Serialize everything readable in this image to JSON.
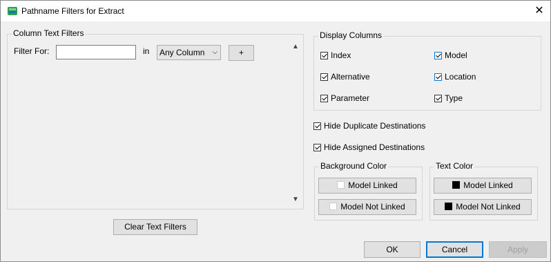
{
  "window": {
    "title": "Pathname Filters for Extract",
    "close_glyph": "✕"
  },
  "column_text_filters": {
    "legend": "Column Text Filters",
    "filter_for_label": "Filter For:",
    "filter_value": "",
    "in_label": "in",
    "column_select": "Any Column",
    "add_label": "+",
    "clear_label": "Clear Text Filters"
  },
  "display_columns": {
    "legend": "Display Columns",
    "items": [
      {
        "label": "Index",
        "checked": true
      },
      {
        "label": "Model",
        "checked": true
      },
      {
        "label": "Alternative",
        "checked": true
      },
      {
        "label": "Location",
        "checked": true
      },
      {
        "label": "Parameter",
        "checked": true
      },
      {
        "label": "Type",
        "checked": true
      }
    ]
  },
  "options": {
    "hide_duplicate": "Hide Duplicate Destinations",
    "hide_assigned": "Hide Assigned Destinations"
  },
  "background_color": {
    "legend": "Background Color",
    "linked": "Model Linked",
    "not_linked": "Model Not Linked",
    "swatch_color": "#ffffff"
  },
  "text_color": {
    "legend": "Text Color",
    "linked": "Model Linked",
    "not_linked": "Model Not Linked",
    "swatch_color": "#000000"
  },
  "footer": {
    "ok": "OK",
    "cancel": "Cancel",
    "apply": "Apply"
  }
}
